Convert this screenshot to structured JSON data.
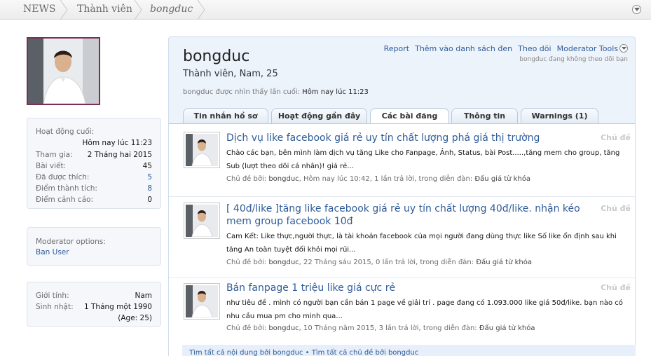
{
  "breadcrumb": {
    "items": [
      "NEWS",
      "Thành viên",
      "bongduc"
    ]
  },
  "sidebar": {
    "stats": [
      {
        "label": "Hoạt động cuối:",
        "value": "Hôm nay lúc 11:23"
      },
      {
        "label": "Tham gia:",
        "value": "2 Tháng hai 2015"
      },
      {
        "label": "Bài viết:",
        "value": "45"
      },
      {
        "label": "Đã được thích:",
        "value": "5"
      },
      {
        "label": "Điểm thành tích:",
        "value": "8"
      },
      {
        "label": "Điểm cảnh cáo:",
        "value": "0"
      }
    ],
    "moderator": {
      "label": "Moderator options:",
      "link": "Ban User"
    },
    "info": [
      {
        "label": "Giới tính:",
        "value": "Nam"
      },
      {
        "label": "Sinh nhật:",
        "value": "1 Tháng một 1990"
      }
    ],
    "age": "(Age: 25)"
  },
  "profile": {
    "username": "bongduc",
    "title": "Thành viên, Nam, 25",
    "last_seen_label": "bongduc được nhìn thấy lần cuối:",
    "last_seen_value": "Hôm nay lúc 11:23",
    "actions": [
      "Report",
      "Thêm vào danh sách đen",
      "Theo dõi",
      "Moderator Tools"
    ],
    "follow_note": "bongduc đang không theo dõi bạn"
  },
  "tabs": [
    "Tin nhắn hồ sơ",
    "Hoạt động gần đây",
    "Các bài đăng",
    "Thông tin",
    "Warnings (1)"
  ],
  "posts": [
    {
      "title": "Dịch vụ like facebook giá rẻ uy tín chất lượng phá giá thị trường",
      "type": "Chủ đề",
      "snippet": "Chào các bạn, bên mình làm dịch vụ tăng Like cho Fanpage, Ảnh, Status, bài Post.....,tăng mem cho group, tăng Sub (lượt theo dõi cá nhân)! giá rẻ...",
      "by": "Chủ đề bởi:",
      "user": "bongduc",
      "details": ", Hôm nay lúc 10:42, 1 lần trả lời, trong diễn đàn:",
      "forum": "Đấu giá từ khóa"
    },
    {
      "title": "[ 40đ/like ]tăng like facebook giá rẻ uy tín chất lượng 40đ/like. nhận kéo mem group facebook 10đ",
      "type": "Chủ đề",
      "snippet": "Cam Kết: Like thực,người thực, là tài khoản facebook của mọi người đang dùng thực like Số like ổn định sau khi tăng An toàn tuyệt đối khỏi mọi rủi...",
      "by": "Chủ đề bởi:",
      "user": "bongduc",
      "details": ", 22 Tháng sáu 2015, 0 lần trả lời, trong diễn đàn:",
      "forum": "Đấu giá từ khóa"
    },
    {
      "title": "Bán fanpage 1 triệu like giá cực rẻ",
      "type": "Chủ đề",
      "snippet": "như tiêu đề . mình có người bạn cần bán 1 page về giải trí . page đang có 1.093.000 like giá 50đ/like. bạn nào có nhu cầu mua pm cho minh qua...",
      "by": "Chủ đề bởi:",
      "user": "bongduc",
      "details": ", 10 Tháng năm 2015, 3 lần trả lời, trong diễn đàn:",
      "forum": "Đấu giá từ khóa"
    }
  ],
  "footer": {
    "links": "Tìm tất cả nội dung bởi bongduc • Tìm tất cả chủ đề bởi bongduc"
  },
  "icons": {
    "jump": "chevron-down-icon",
    "avatar": "user-photo"
  },
  "colors": {
    "link": "#2f5c9a",
    "avatar_border": "#7c2f56",
    "header_bg": "#edf3fb"
  }
}
